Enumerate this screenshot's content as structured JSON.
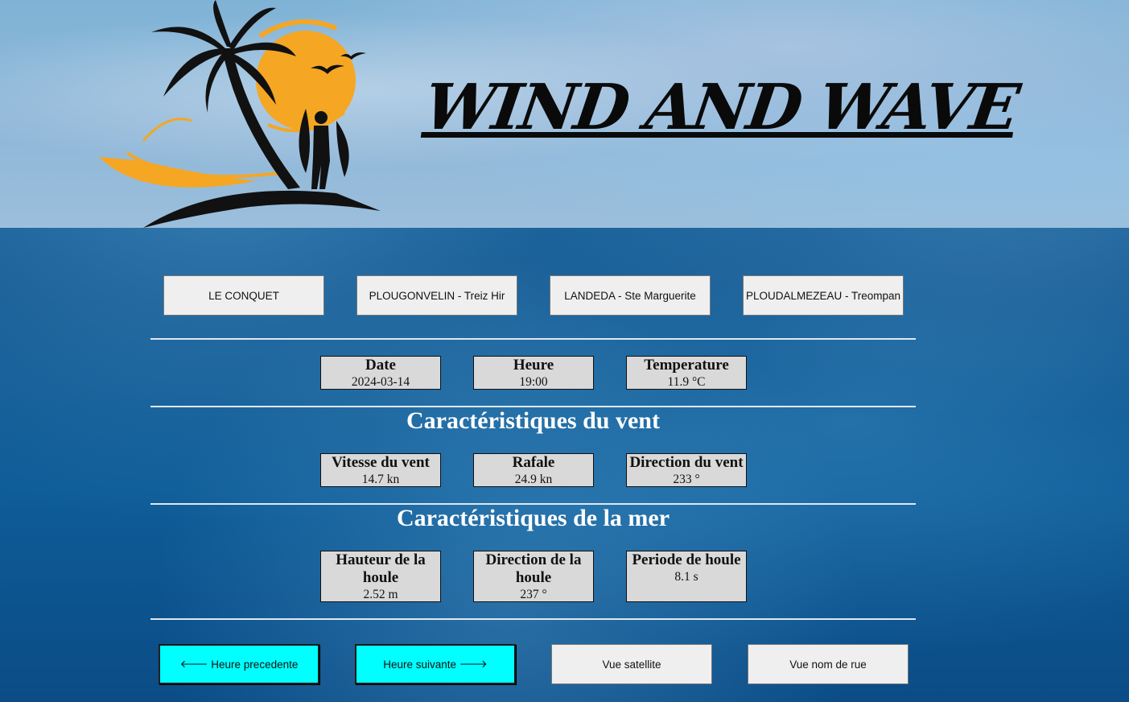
{
  "header": {
    "title": "WIND AND WAVE"
  },
  "spots": [
    {
      "label": "LE CONQUET"
    },
    {
      "label": "PLOUGONVELIN - Treiz Hir"
    },
    {
      "label": "LANDEDA - Ste Marguerite"
    },
    {
      "label": "PLOUDALMEZEAU - Treompan"
    }
  ],
  "general": {
    "date": {
      "label": "Date",
      "value": "2024-03-14"
    },
    "hour": {
      "label": "Heure",
      "value": "19:00"
    },
    "temperature": {
      "label": "Temperature",
      "value": "11.9 °C"
    }
  },
  "wind": {
    "title": "Caractéristiques du vent",
    "speed": {
      "label": "Vitesse du vent",
      "value": "14.7 kn"
    },
    "gust": {
      "label": "Rafale",
      "value": "24.9 kn"
    },
    "direction": {
      "label": "Direction du vent",
      "value": "233 °"
    }
  },
  "sea": {
    "title": "Caractéristiques de la mer",
    "height": {
      "label": "Hauteur de la houle",
      "value": "2.52 m"
    },
    "direction": {
      "label": "Direction de la houle",
      "value": "237 °"
    },
    "period": {
      "label": "Periode de houle",
      "value": "8.1 s"
    }
  },
  "nav": {
    "prev_arrow": "🡐",
    "prev_label": "Heure precedente",
    "next_label": "Heure suivante",
    "next_arrow": "🡒",
    "satellite_label": "Vue satellite",
    "street_label": "Vue nom de rue"
  },
  "colors": {
    "accent_cyan": "#00ffff",
    "sun_orange": "#f5a623",
    "ocean_blue": "#0a4f8a"
  }
}
